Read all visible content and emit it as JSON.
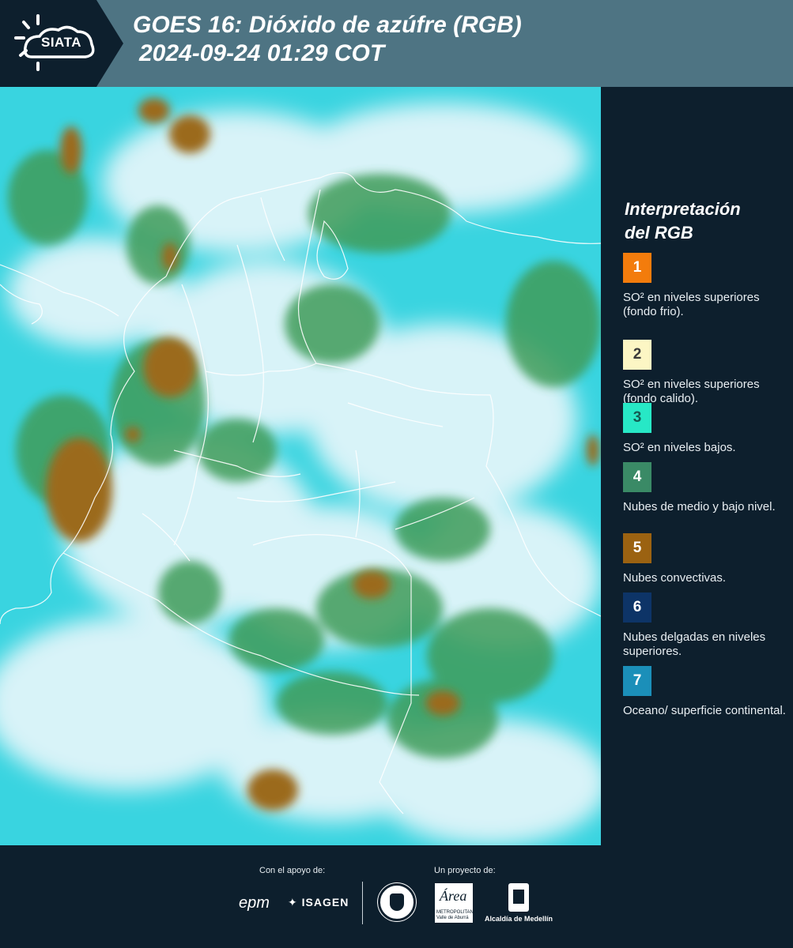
{
  "header": {
    "logo_text": "SIATA",
    "title_line1": "GOES 16: Dióxido de azúfre (RGB)",
    "title_line2": "2024-09-24 01:29 COT"
  },
  "legend": {
    "title_line1": "Interpretación",
    "title_line2": "del RGB",
    "items": [
      {
        "num": "1",
        "label": "SO² en niveles superiores (fondo frio).",
        "color": "#f37c0c",
        "text_color": "#ffffff"
      },
      {
        "num": "2",
        "label": "SO² en niveles superiores (fondo calido).",
        "color": "#fcf6c4",
        "text_color": "#3a3a3a"
      },
      {
        "num": "3",
        "label": "SO² en niveles bajos.",
        "color": "#27e8c6",
        "text_color": "#155a52"
      },
      {
        "num": "4",
        "label": "Nubes de medio y bajo nivel.",
        "color": "#3a8a66",
        "text_color": "#ffffff"
      },
      {
        "num": "5",
        "label": "Nubes convectivas.",
        "color": "#9b6211",
        "text_color": "#ffffff"
      },
      {
        "num": "6",
        "label": "Nubes delgadas en niveles superiores.",
        "color": "#0d3467",
        "text_color": "#ffffff"
      },
      {
        "num": "7",
        "label": "Oceano/ superficie continental.",
        "color": "#1b8fb9",
        "text_color": "#ffffff"
      }
    ]
  },
  "footer": {
    "support_label": "Con el apoyo de:",
    "project_label": "Un proyecto de:",
    "epm": "epm",
    "isagen": "ISAGEN",
    "metro_big": "Área",
    "metro_small": "METROPOLITANA Valle de Aburrá",
    "alcaldia": "Alcaldía de Medellín"
  },
  "map_colors": {
    "background": "#39d4e0",
    "cloud_white": "#d8f3f8",
    "green": "#3f9c5a",
    "brown": "#9b6a1d",
    "border": "#ffffff"
  }
}
